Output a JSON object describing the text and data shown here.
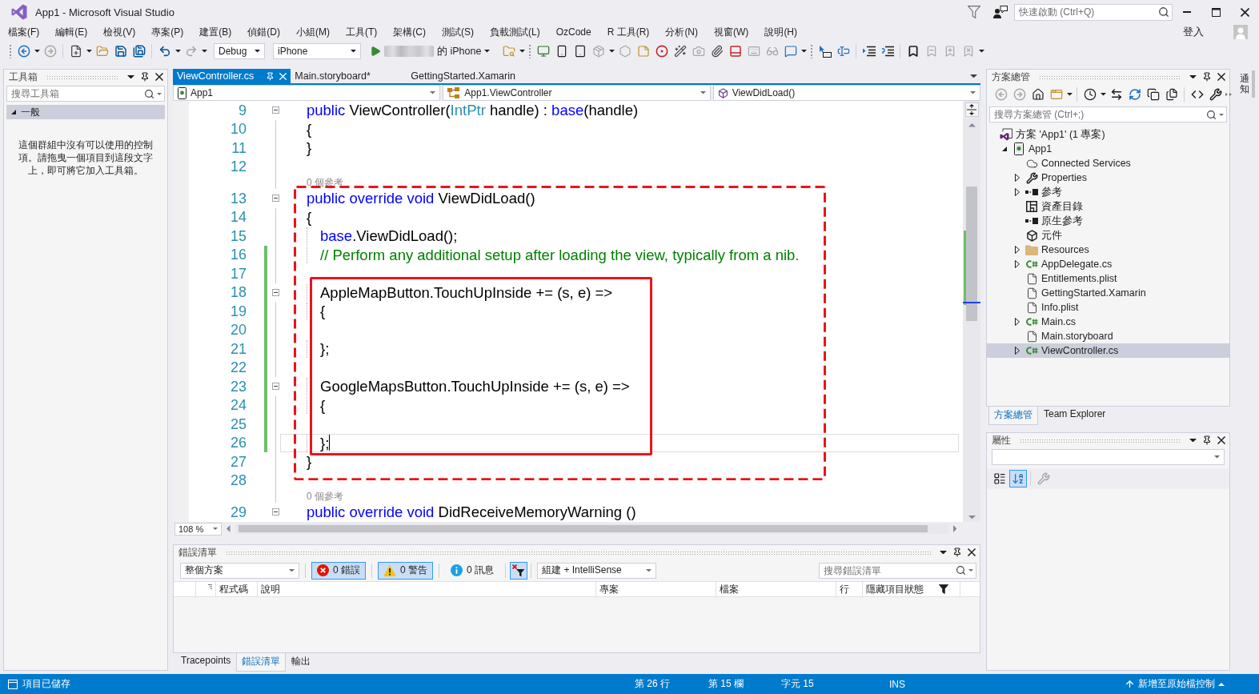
{
  "window": {
    "title": "App1 - Microsoft Visual Studio"
  },
  "quick_launch": {
    "placeholder": "快速啟動 (Ctrl+Q)"
  },
  "menu": {
    "items": [
      "檔案(F)",
      "編輯(E)",
      "檢視(V)",
      "專案(P)",
      "建置(B)",
      "偵錯(D)",
      "小組(M)",
      "工具(T)",
      "架構(C)",
      "測試(S)",
      "負載測試(L)",
      "OzCode",
      "R 工具(R)",
      "分析(N)",
      "視窗(W)",
      "說明(H)"
    ],
    "sign_in": "登入"
  },
  "toolbar": {
    "items": [
      {
        "kind": "grip"
      },
      {
        "kind": "button",
        "disabled": false
      },
      {
        "kind": "caret"
      },
      {
        "kind": "button",
        "disabled": true
      },
      {
        "kind": "separator"
      },
      {
        "kind": "button",
        "disabled": false
      },
      {
        "kind": "caret"
      },
      {
        "kind": "button",
        "disabled": false
      },
      {
        "kind": "button",
        "disabled": false
      },
      {
        "kind": "button",
        "disabled": false
      },
      {
        "kind": "separator"
      },
      {
        "kind": "button",
        "disabled": false
      },
      {
        "kind": "caret"
      },
      {
        "kind": "button",
        "disabled": true
      },
      {
        "kind": "caret"
      },
      {
        "kind": "select",
        "value": "Debug"
      },
      {
        "kind": "select",
        "value": "iPhone"
      },
      {
        "kind": "run",
        "label": "的 iPhone"
      },
      {
        "kind": "button",
        "disabled": false
      },
      {
        "kind": "caret"
      },
      {
        "kind": "grip"
      },
      {
        "kind": "button",
        "disabled": false
      },
      {
        "kind": "button",
        "disabled": false
      },
      {
        "kind": "button",
        "disabled": false
      },
      {
        "kind": "button",
        "disabled": true
      },
      {
        "kind": "caret"
      },
      {
        "kind": "button",
        "disabled": true
      },
      {
        "kind": "button",
        "disabled": false
      },
      {
        "kind": "button",
        "disabled": false
      },
      {
        "kind": "button",
        "disabled": false
      },
      {
        "kind": "button",
        "disabled": true
      },
      {
        "kind": "button",
        "disabled": false
      },
      {
        "kind": "button",
        "disabled": false
      },
      {
        "kind": "button",
        "disabled": true
      },
      {
        "kind": "button",
        "disabled": true
      },
      {
        "kind": "button",
        "disabled": false
      },
      {
        "kind": "caret"
      },
      {
        "kind": "grip"
      },
      {
        "kind": "button",
        "disabled": false
      },
      {
        "kind": "button",
        "disabled": false
      },
      {
        "kind": "separator"
      },
      {
        "kind": "button",
        "disabled": false
      },
      {
        "kind": "button",
        "disabled": false
      },
      {
        "kind": "separator"
      },
      {
        "kind": "button",
        "disabled": false
      },
      {
        "kind": "button",
        "disabled": true
      },
      {
        "kind": "button",
        "disabled": true
      },
      {
        "kind": "button",
        "disabled": true
      },
      {
        "kind": "caret"
      }
    ]
  },
  "toolbox": {
    "title": "工具箱",
    "search": {
      "placeholder": "搜尋工具箱"
    },
    "groups": [
      {
        "label": "一般",
        "expanded": true,
        "empty_text": "這個群組中沒有可以使用的控制項。請拖曳一個項目到這段文字上，即可將它加入工具箱。"
      }
    ]
  },
  "editor": {
    "tabs": [
      {
        "label": "ViewController.cs",
        "selected": true
      },
      {
        "label": "Main.storyboard*",
        "selected": false
      },
      {
        "label": "GettingStarted.Xamarin",
        "selected": false
      }
    ],
    "navigation": {
      "project": "App1",
      "type": "App1.ViewController",
      "member": "ViewDidLoad()"
    },
    "lines": [
      {
        "kind": "code",
        "number": "9",
        "collapsible": true,
        "changed": false,
        "current": false,
        "indented": false,
        "tokens": [
          {
            "text": "public",
            "kind": "keyword"
          },
          {
            "text": " ViewController(",
            "kind": "plain"
          },
          {
            "text": "IntPtr",
            "kind": "type"
          },
          {
            "text": " handle) : ",
            "kind": "plain"
          },
          {
            "text": "base",
            "kind": "keyword"
          },
          {
            "text": "(handle)",
            "kind": "plain"
          }
        ]
      },
      {
        "kind": "code",
        "number": "10",
        "collapsible": false,
        "changed": false,
        "current": false,
        "indented": false,
        "tokens": [
          {
            "text": "{",
            "kind": "plain"
          }
        ]
      },
      {
        "kind": "code",
        "number": "11",
        "collapsible": false,
        "changed": false,
        "current": false,
        "indented": false,
        "tokens": [
          {
            "text": "}",
            "kind": "plain"
          }
        ]
      },
      {
        "kind": "code",
        "number": "12",
        "collapsible": false,
        "changed": false,
        "current": false
      },
      {
        "kind": "codelens",
        "text": "0 個參考"
      },
      {
        "kind": "code",
        "number": "13",
        "collapsible": true,
        "changed": false,
        "current": false,
        "indented": false,
        "tokens": [
          {
            "text": "public override void",
            "kind": "keyword"
          },
          {
            "text": " ViewDidLoad()",
            "kind": "plain"
          }
        ]
      },
      {
        "kind": "code",
        "number": "14",
        "collapsible": false,
        "changed": false,
        "current": false,
        "indented": false,
        "tokens": [
          {
            "text": "{",
            "kind": "plain"
          }
        ]
      },
      {
        "kind": "code",
        "number": "15",
        "collapsible": false,
        "changed": false,
        "current": false,
        "indented": true,
        "tokens": [
          {
            "text": "base",
            "kind": "keyword"
          },
          {
            "text": ".ViewDidLoad();",
            "kind": "plain"
          }
        ]
      },
      {
        "kind": "code",
        "number": "16",
        "collapsible": false,
        "changed": true,
        "current": false,
        "indented": true,
        "tokens": [
          {
            "text": "// Perform any additional setup after loading the view, typically from a nib.",
            "kind": "comment"
          }
        ]
      },
      {
        "kind": "code",
        "number": "17",
        "collapsible": false,
        "changed": true,
        "current": false
      },
      {
        "kind": "code",
        "number": "18",
        "collapsible": true,
        "changed": true,
        "current": false,
        "indented": true,
        "tokens": [
          {
            "text": "AppleMapButton.TouchUpInside += (s, e) =>",
            "kind": "plain"
          }
        ]
      },
      {
        "kind": "code",
        "number": "19",
        "collapsible": false,
        "changed": true,
        "current": false,
        "indented": true,
        "tokens": [
          {
            "text": "{",
            "kind": "plain"
          }
        ]
      },
      {
        "kind": "code",
        "number": "20",
        "collapsible": false,
        "changed": true,
        "current": false
      },
      {
        "kind": "code",
        "number": "21",
        "collapsible": false,
        "changed": true,
        "current": false,
        "indented": true,
        "tokens": [
          {
            "text": "};",
            "kind": "plain"
          }
        ]
      },
      {
        "kind": "code",
        "number": "22",
        "collapsible": false,
        "changed": true,
        "current": false
      },
      {
        "kind": "code",
        "number": "23",
        "collapsible": true,
        "changed": true,
        "current": false,
        "indented": true,
        "tokens": [
          {
            "text": "GoogleMapsButton.TouchUpInside += (s, e) =>",
            "kind": "plain"
          }
        ]
      },
      {
        "kind": "code",
        "number": "24",
        "collapsible": false,
        "changed": true,
        "current": false,
        "indented": true,
        "tokens": [
          {
            "text": "{",
            "kind": "plain"
          }
        ]
      },
      {
        "kind": "code",
        "number": "25",
        "collapsible": false,
        "changed": true,
        "current": false
      },
      {
        "kind": "code",
        "number": "26",
        "collapsible": false,
        "changed": true,
        "current": true,
        "indented": true,
        "tokens": [
          {
            "text": "};",
            "kind": "plain"
          }
        ]
      },
      {
        "kind": "code",
        "number": "27",
        "collapsible": false,
        "changed": false,
        "current": false,
        "indented": false,
        "tokens": [
          {
            "text": "}",
            "kind": "plain"
          }
        ]
      },
      {
        "kind": "code",
        "number": "28",
        "collapsible": false,
        "changed": false,
        "current": false
      },
      {
        "kind": "codelens",
        "text": "0 個參考"
      },
      {
        "kind": "code",
        "number": "29",
        "collapsible": true,
        "changed": false,
        "current": false,
        "indented": false,
        "tokens": [
          {
            "text": "public override void",
            "kind": "keyword"
          },
          {
            "text": " DidReceiveMemoryWarning ()",
            "kind": "plain"
          }
        ]
      }
    ],
    "zoom": "108 %"
  },
  "error_list": {
    "title": "錯誤清單",
    "scope": "整個方案",
    "filters": [
      {
        "kind": "error",
        "label": "0 錯誤",
        "selected": true
      },
      {
        "kind": "warning",
        "label": "0 警告",
        "selected": true
      },
      {
        "kind": "message",
        "label": "0 訊息",
        "selected": false
      }
    ],
    "filter_toggle": {
      "selected": true
    },
    "source": "組建 + IntelliSense",
    "search": {
      "placeholder": "搜尋錯誤清單"
    },
    "columns": [
      "程式碼",
      "說明",
      "專案",
      "檔案",
      "行",
      "隱藏項目狀態"
    ],
    "tabs": [
      {
        "label": "Tracepoints",
        "selected": false
      },
      {
        "label": "錯誤清單",
        "selected": true
      },
      {
        "label": "輸出",
        "selected": false
      }
    ]
  },
  "solution_explorer": {
    "title": "方案總管",
    "toolbar": [
      {
        "kind": "button",
        "disabled": true
      },
      {
        "kind": "button",
        "disabled": true
      },
      {
        "kind": "button",
        "disabled": false
      },
      {
        "kind": "button",
        "disabled": false
      },
      {
        "kind": "caret"
      },
      {
        "kind": "separator"
      },
      {
        "kind": "button",
        "disabled": false
      },
      {
        "kind": "caret"
      },
      {
        "kind": "button",
        "disabled": false
      },
      {
        "kind": "button",
        "disabled": false
      },
      {
        "kind": "button",
        "disabled": false
      },
      {
        "kind": "button",
        "disabled": false
      },
      {
        "kind": "separator"
      },
      {
        "kind": "button",
        "disabled": false
      },
      {
        "kind": "button",
        "disabled": false
      },
      {
        "kind": "overflow"
      }
    ],
    "search": {
      "placeholder": "搜尋方案總管 (Ctrl+;)"
    },
    "tree": [
      {
        "label": "方案 'App1' (1 專案)",
        "kind": "solution",
        "selected": false,
        "children": [
          {
            "label": "App1",
            "kind": "project",
            "expanded": true,
            "selected": false,
            "children": [
              {
                "label": "Connected Services",
                "kind": "service",
                "selected": false
              },
              {
                "label": "Properties",
                "kind": "properties",
                "expanded": false,
                "selected": false
              },
              {
                "label": "參考",
                "kind": "references",
                "expanded": false,
                "selected": false
              },
              {
                "label": "資產目錄",
                "kind": "asset-catalog",
                "selected": false
              },
              {
                "label": "原生參考",
                "kind": "native-references",
                "selected": false
              },
              {
                "label": "元件",
                "kind": "components",
                "selected": false
              },
              {
                "label": "Resources",
                "kind": "folder",
                "expanded": false,
                "selected": false
              },
              {
                "label": "AppDelegate.cs",
                "kind": "csharp",
                "expanded": false,
                "selected": false
              },
              {
                "label": "Entitlements.plist",
                "kind": "file",
                "selected": false
              },
              {
                "label": "GettingStarted.Xamarin",
                "kind": "file",
                "selected": false
              },
              {
                "label": "Info.plist",
                "kind": "file",
                "selected": false
              },
              {
                "label": "Main.cs",
                "kind": "csharp",
                "expanded": false,
                "selected": false
              },
              {
                "label": "Main.storyboard",
                "kind": "file",
                "selected": false
              },
              {
                "label": "ViewController.cs",
                "kind": "csharp",
                "expanded": false,
                "selected": true
              }
            ]
          }
        ]
      }
    ],
    "tabs": [
      {
        "label": "方案總管",
        "selected": true
      },
      {
        "label": "Team Explorer",
        "selected": false
      }
    ]
  },
  "properties": {
    "title": "屬性",
    "toolbar": [
      {
        "kind": "button",
        "selected": false
      },
      {
        "kind": "button",
        "selected": true
      },
      {
        "kind": "separator"
      },
      {
        "kind": "button",
        "disabled": true
      }
    ]
  },
  "side_tabs": [
    {
      "label": "通知"
    }
  ],
  "status_bar": {
    "message": "項目已儲存",
    "position": [
      "第 26 行",
      "第 15 欄",
      "字元 15"
    ],
    "mode": "INS",
    "source_control": "新增至原始檔控制"
  }
}
